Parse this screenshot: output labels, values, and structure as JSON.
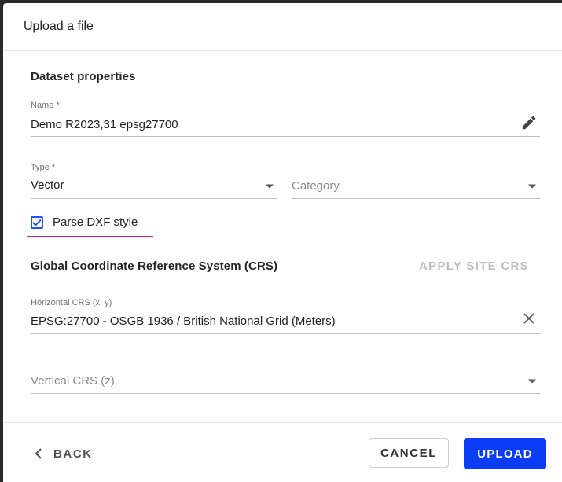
{
  "dialog": {
    "title": "Upload a file"
  },
  "dataset": {
    "section_title": "Dataset properties",
    "name": {
      "label": "Name *",
      "value": "Demo R2023,31 epsg27700"
    },
    "type": {
      "label": "Type *",
      "value": "Vector"
    },
    "category": {
      "placeholder": "Category"
    },
    "parse_dxf": {
      "label": "Parse DXF style",
      "checked": true
    }
  },
  "crs": {
    "section_title": "Global Coordinate Reference System (CRS)",
    "apply_site_label": "APPLY SITE CRS",
    "horizontal": {
      "label": "Horizontal CRS (x, y)",
      "value": "EPSG:27700 - OSGB 1936 / British National Grid (Meters)"
    },
    "vertical": {
      "placeholder": "Vertical CRS (z)"
    }
  },
  "footer": {
    "back_label": "BACK",
    "cancel_label": "CANCEL",
    "upload_label": "UPLOAD"
  },
  "colors": {
    "accent": "#0b3cf6",
    "checkbox": "#1a56f0",
    "focus_underline": "#d81b9a"
  },
  "icons": {
    "name_edit": "pencil-icon",
    "type_dropdown": "caret-down-icon",
    "category_dropdown": "caret-down-icon",
    "horizontal_clear": "close-icon",
    "vertical_dropdown": "caret-down-icon",
    "back": "chevron-left-icon",
    "checkbox": "checkmark-icon"
  }
}
